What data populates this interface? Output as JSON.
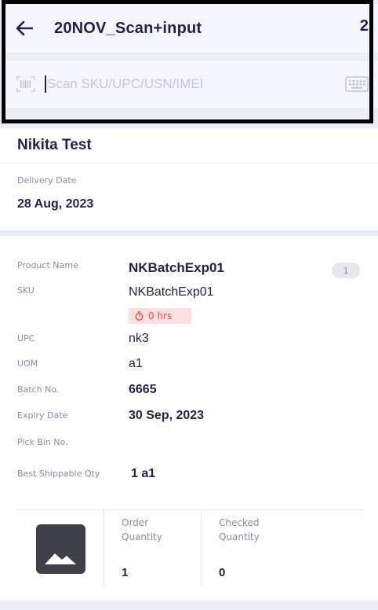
{
  "header": {
    "title": "20NOV_Scan+input",
    "count": "2",
    "back_icon": "arrow-left-icon"
  },
  "scan": {
    "placeholder": "Scan SKU/UPC/USN/IMEI",
    "value": "",
    "barcode_icon": "barcode-icon",
    "keyboard_icon": "keyboard-icon"
  },
  "customer": {
    "name": "Nikita Test",
    "delivery_date_label": "Delivery Date",
    "delivery_date": "28 Aug, 2023"
  },
  "product": {
    "qty_badge": "1",
    "timer_icon": "timer-icon",
    "timer_text": "0 hrs",
    "fields": [
      {
        "label": "Product Name",
        "value": "NKBatchExp01"
      },
      {
        "label": "SKU",
        "value": "NKBatchExp01"
      },
      {
        "label": "UPC",
        "value": "nk3"
      },
      {
        "label": "UOM",
        "value": "a1"
      },
      {
        "label": "Batch No.",
        "value": "6665"
      },
      {
        "label": "Expiry Date",
        "value": "30 Sep, 2023"
      },
      {
        "label": "Pick Bin No.",
        "value": ""
      },
      {
        "label": "Best Shippable Qty",
        "value": "1 a1"
      }
    ],
    "image_icon": "image-placeholder-icon",
    "order_quantity_label": "Order\nQuantity",
    "order_quantity": "1",
    "checked_quantity_label": "Checked\nQuantity",
    "checked_quantity": "0"
  },
  "colors": {
    "primary_text": "#1f2446",
    "muted_text": "#8a8da3",
    "background": "#eceef5",
    "timer_badge_bg": "#fbe0e0",
    "timer_badge_text": "#e4524f"
  }
}
